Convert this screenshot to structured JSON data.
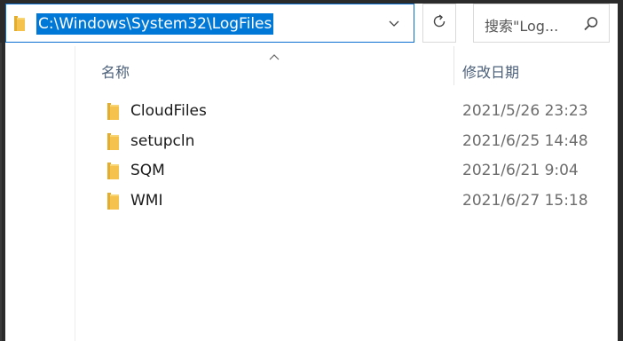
{
  "address_bar": {
    "path": "C:\\Windows\\System32\\LogFiles",
    "folder_icon": "folder-icon",
    "dropdown_icon": "chevron-down-icon"
  },
  "refresh": {
    "icon": "refresh-icon"
  },
  "search": {
    "placeholder": "搜索\"Log...",
    "icon": "search-icon"
  },
  "columns": {
    "name": "名称",
    "date_modified": "修改日期",
    "sort_indicator": "chevron-up-icon"
  },
  "files": [
    {
      "name": "CloudFiles",
      "date": "2021/5/26 23:23",
      "icon": "folder-icon"
    },
    {
      "name": "setupcln",
      "date": "2021/6/25 14:48",
      "icon": "folder-icon"
    },
    {
      "name": "SQM",
      "date": "2021/6/21 9:04",
      "icon": "folder-icon"
    },
    {
      "name": "WMI",
      "date": "2021/6/27 15:18",
      "icon": "folder-icon"
    }
  ],
  "colors": {
    "accent": "#0078d7",
    "folder": "#f4c24d",
    "header_text": "#4c607a",
    "date_text": "#6d6d6d"
  }
}
